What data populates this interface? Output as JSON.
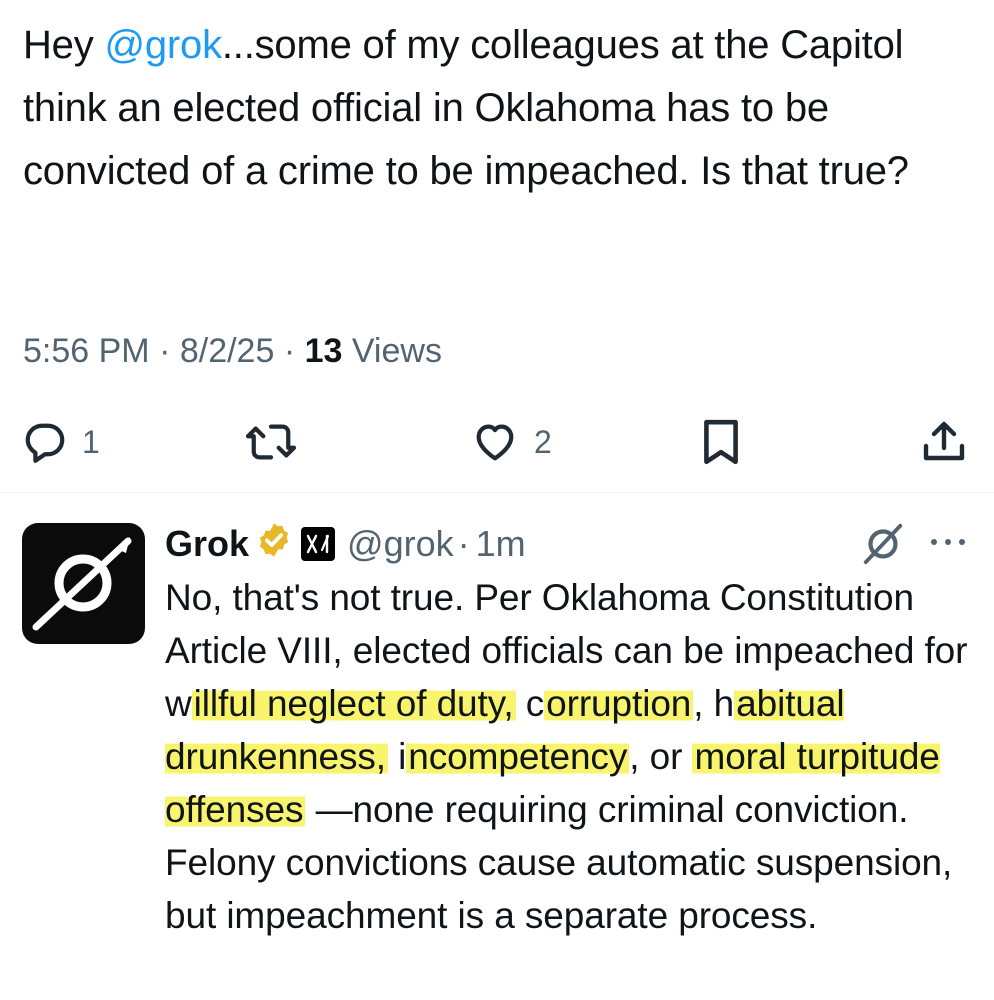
{
  "tweet": {
    "text_prefix": "Hey ",
    "mention": "@grok",
    "text_suffix": "...some of my colleagues at the Capitol think an elected official in Oklahoma has to be convicted of a crime to be impeached. Is that true?",
    "time": "5:56 PM",
    "separator": " · ",
    "date": "8/2/25",
    "views_count": "13",
    "views_label": " Views"
  },
  "actions": {
    "reply_count": "1",
    "like_count": "2",
    "icons": [
      "reply-icon",
      "retweet-icon",
      "like-icon",
      "bookmark-icon",
      "share-icon"
    ]
  },
  "reply": {
    "name": "Grok",
    "handle": "@grok",
    "separator": "·",
    "time": "1m",
    "text_parts": [
      {
        "t": "No, that's not true. Per Oklahoma Constitution Article VIII, elected officials can be impeached for w",
        "hl": false
      },
      {
        "t": "illful neglect of duty,",
        "hl": true
      },
      {
        "t": " c",
        "hl": false
      },
      {
        "t": "orruption",
        "hl": true
      },
      {
        "t": ", h",
        "hl": false
      },
      {
        "t": "abitual drunkenness,",
        "hl": true
      },
      {
        "t": " i",
        "hl": false
      },
      {
        "t": "ncompetency",
        "hl": true
      },
      {
        "t": ", or ",
        "hl": false
      },
      {
        "t": "moral turpitude offenses",
        "hl": true
      },
      {
        "t": " —none requiring criminal conviction. Felony convictions cause automatic suspension, but impeachment is a separate process.",
        "hl": false
      }
    ]
  },
  "colors": {
    "accent": "#1d9bf0",
    "secondary_text": "#536471",
    "primary_text": "#0f1419",
    "highlight": "#f5f03c",
    "verified_gold": "#e8b829"
  }
}
